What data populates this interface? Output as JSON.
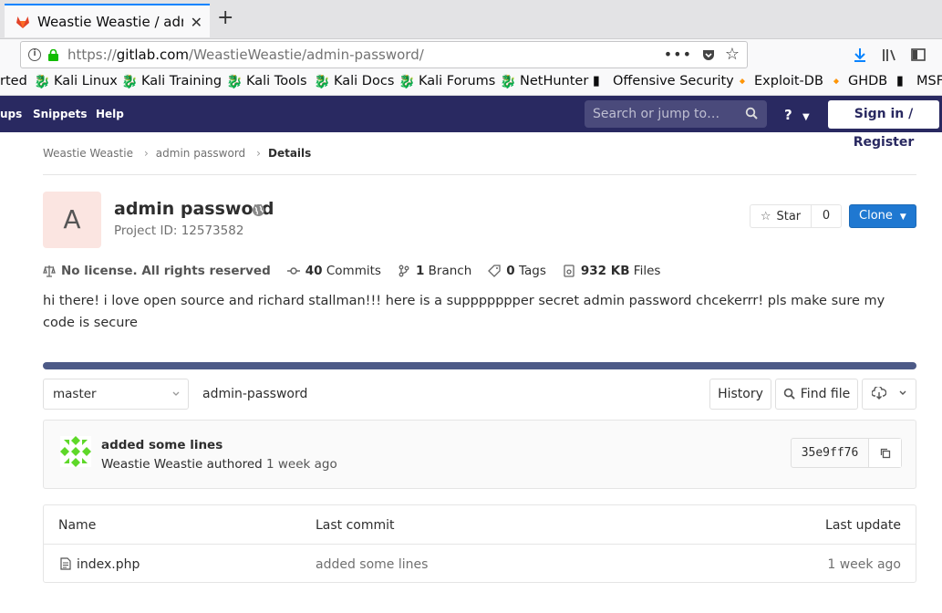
{
  "browser": {
    "tab_title": "Weastie Weastie / admin-password",
    "url_prefix": "https://",
    "url_domain": "gitlab.com",
    "url_path": "/WeastieWeastie/admin-password/",
    "dots": "•••",
    "bookmarks": [
      "rted",
      "Kali Linux",
      "Kali Training",
      "Kali Tools",
      "Kali Docs",
      "Kali Forums",
      "NetHunter",
      "Offensive Security",
      "Exploit-DB",
      "GHDB",
      "MSF"
    ]
  },
  "gitlab_nav": {
    "items": [
      "ups",
      "Snippets",
      "Help"
    ],
    "search_placeholder": "Search or jump to…",
    "help_icon": "?",
    "sign_in": "Sign in / Register"
  },
  "breadcrumb": {
    "items": [
      "Weastie Weastie",
      "admin password"
    ],
    "current": "Details"
  },
  "project": {
    "avatar_letter": "A",
    "name": "admin password",
    "id_label": "Project ID: 12573582",
    "star_label": "Star",
    "star_count": "0",
    "clone_label": "Clone",
    "stats": {
      "license": "No license. All rights reserved",
      "commits_count": "40",
      "commits_label": "Commits",
      "branch_count": "1",
      "branch_label": "Branch",
      "tags_count": "0",
      "tags_label": "Tags",
      "files_size": "932 KB",
      "files_label": "Files"
    },
    "description": "hi there! i love open source and richard stallman!!! here is a suppppppper secret admin password chcekerrr! pls make sure my code is secure"
  },
  "repo": {
    "branch": "master",
    "path": "admin-password",
    "history_label": "History",
    "find_file_label": "Find file"
  },
  "last_commit": {
    "title": "added some lines",
    "author": "Weastie Weastie",
    "authored": "authored",
    "when": "1 week ago",
    "sha": "35e9ff76"
  },
  "files_table": {
    "headers": {
      "name": "Name",
      "last_commit": "Last commit",
      "last_update": "Last update"
    },
    "rows": [
      {
        "name": "index.php",
        "commit": "added some lines",
        "updated": "1 week ago"
      }
    ]
  },
  "colors": {
    "nav_bg": "#292961",
    "accent_blue": "#1f78d1",
    "progress": "#4d5a87",
    "avatar_bg": "#fbe5e1"
  }
}
